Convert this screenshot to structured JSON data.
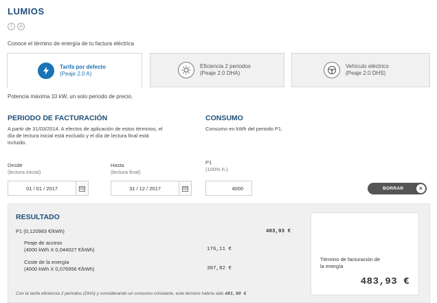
{
  "brand": "LUMIOS",
  "social_icons": [
    "facebook-icon",
    "linkedin-icon"
  ],
  "intro": "Conoce el término de energía de tu factura eléctrica",
  "tabs": [
    {
      "title": "Tarifa por defecto",
      "subtitle": "(Peaje 2.0 A)",
      "icon": "lightning-icon",
      "active": true
    },
    {
      "title": "Eficiencia 2 periodos",
      "subtitle": "(Peaje 2.0 DHA)",
      "icon": "sun-icon",
      "active": false
    },
    {
      "title": "Vehículo eléctrico",
      "subtitle": "(Peaje 2.0 DHS)",
      "icon": "steering-wheel-icon",
      "active": false
    }
  ],
  "note": "Potencia máxima 10 kW, un solo periodo de precio.",
  "billing": {
    "title": "PERIODO DE FACTURACIÓN",
    "text_1": "A partir de 31/03/2014. A efectos de aplicación de estos términos, el",
    "text_2": "día de lectura inicial está excluido y el día de lectura final está",
    "text_3": "incluido.",
    "from_label": "Desde",
    "from_sub": "(lectura inicial)",
    "from_value": "01 / 01 / 2017",
    "to_label": "Hasta",
    "to_sub": "(lectura final)",
    "to_value": "31 / 12 / 2017"
  },
  "consumption": {
    "title": "CONSUMO",
    "text": "Consumo en kWh del periodo P1.",
    "p1_label": "P1",
    "p1_sub": "(100% h.)",
    "p1_value": "4000"
  },
  "clear_button": "BORRAR",
  "result": {
    "title": "RESULTADO",
    "p1_line": "P1 (0,120983 €/kWh)",
    "p1_total": "483,93 €",
    "access_label": "Peaje de acceso",
    "access_formula": "(4000 kWh X 0,044027 €/kWh)",
    "access_value": "176,11 €",
    "energy_label": "Coste de la energía",
    "energy_formula": "(4000 kWh X 0,076956 €/kWh)",
    "energy_value": "307,82 €",
    "footnote": "Con la tarifa eficiencia 2 periodos (DHA) y considerando un consumo constante, este término habría sido",
    "footnote_value": "481,90 €",
    "total_label_1": "Término de facturación de",
    "total_label_2": "la energía",
    "total_value": "483,93 €"
  },
  "colors": {
    "accent": "#1a73b5",
    "heading": "#1f4e79"
  }
}
